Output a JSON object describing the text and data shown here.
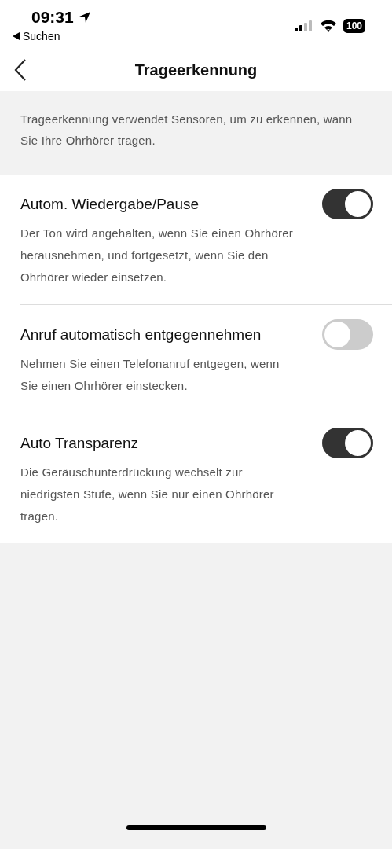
{
  "status_bar": {
    "time": "09:31",
    "back_label": "Suchen",
    "battery": "100"
  },
  "header": {
    "title": "Trageerkennung"
  },
  "description": "Trageerkennung verwendet Sensoren, um zu erkennen, wann Sie Ihre Ohrhörer tragen.",
  "settings": [
    {
      "title": "Autom. Wiedergabe/Pause",
      "description": "Der Ton wird angehalten, wenn Sie einen Ohrhörer herausnehmen, und fortgesetzt, wenn Sie den Ohrhörer wieder einsetzen.",
      "on": true
    },
    {
      "title": "Anruf automatisch entgegennehmen",
      "description": "Nehmen Sie einen Telefonanruf entgegen, wenn Sie einen Ohrhörer einstecken.",
      "on": false
    },
    {
      "title": "Auto Transparenz",
      "description": "Die Geräuschunterdrückung wechselt zur niedrigsten Stufe, wenn Sie nur einen Ohrhörer tragen.",
      "on": true
    }
  ]
}
